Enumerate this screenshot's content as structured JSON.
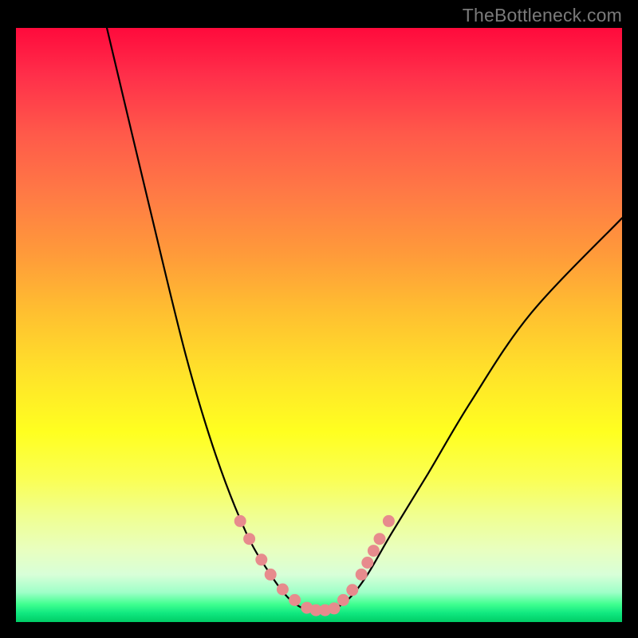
{
  "watermark": "TheBottleneck.com",
  "colors": {
    "curve_stroke": "#000000",
    "marker_fill": "#e78b8d",
    "marker_stroke": "#c96f72",
    "gradient_top": "#ff0a3c",
    "gradient_bottom": "#00cc66",
    "frame_bg": "#000000"
  },
  "chart_data": {
    "type": "line",
    "title": "",
    "xlabel": "",
    "ylabel": "",
    "xlim": [
      0,
      100
    ],
    "ylim": [
      0,
      100
    ],
    "grid": false,
    "legend": false,
    "series": [
      {
        "name": "bottleneck-curve",
        "x": [
          15,
          22,
          28,
          33,
          38,
          42,
          45,
          48,
          50,
          52,
          55,
          58,
          62,
          68,
          75,
          85,
          100
        ],
        "y": [
          100,
          70,
          45,
          28,
          15,
          8,
          4,
          2,
          2,
          2,
          4,
          8,
          15,
          25,
          37,
          52,
          68
        ]
      }
    ],
    "markers": {
      "name": "highlighted-points",
      "x": [
        37,
        38.5,
        40.5,
        42,
        44,
        46,
        48,
        49.5,
        51,
        52.5,
        54,
        55.5,
        57,
        58,
        59,
        60,
        61.5
      ],
      "y": [
        17,
        14,
        10.5,
        8,
        5.5,
        3.7,
        2.4,
        2,
        2,
        2.3,
        3.7,
        5.4,
        8,
        10,
        12,
        14,
        17
      ]
    }
  }
}
